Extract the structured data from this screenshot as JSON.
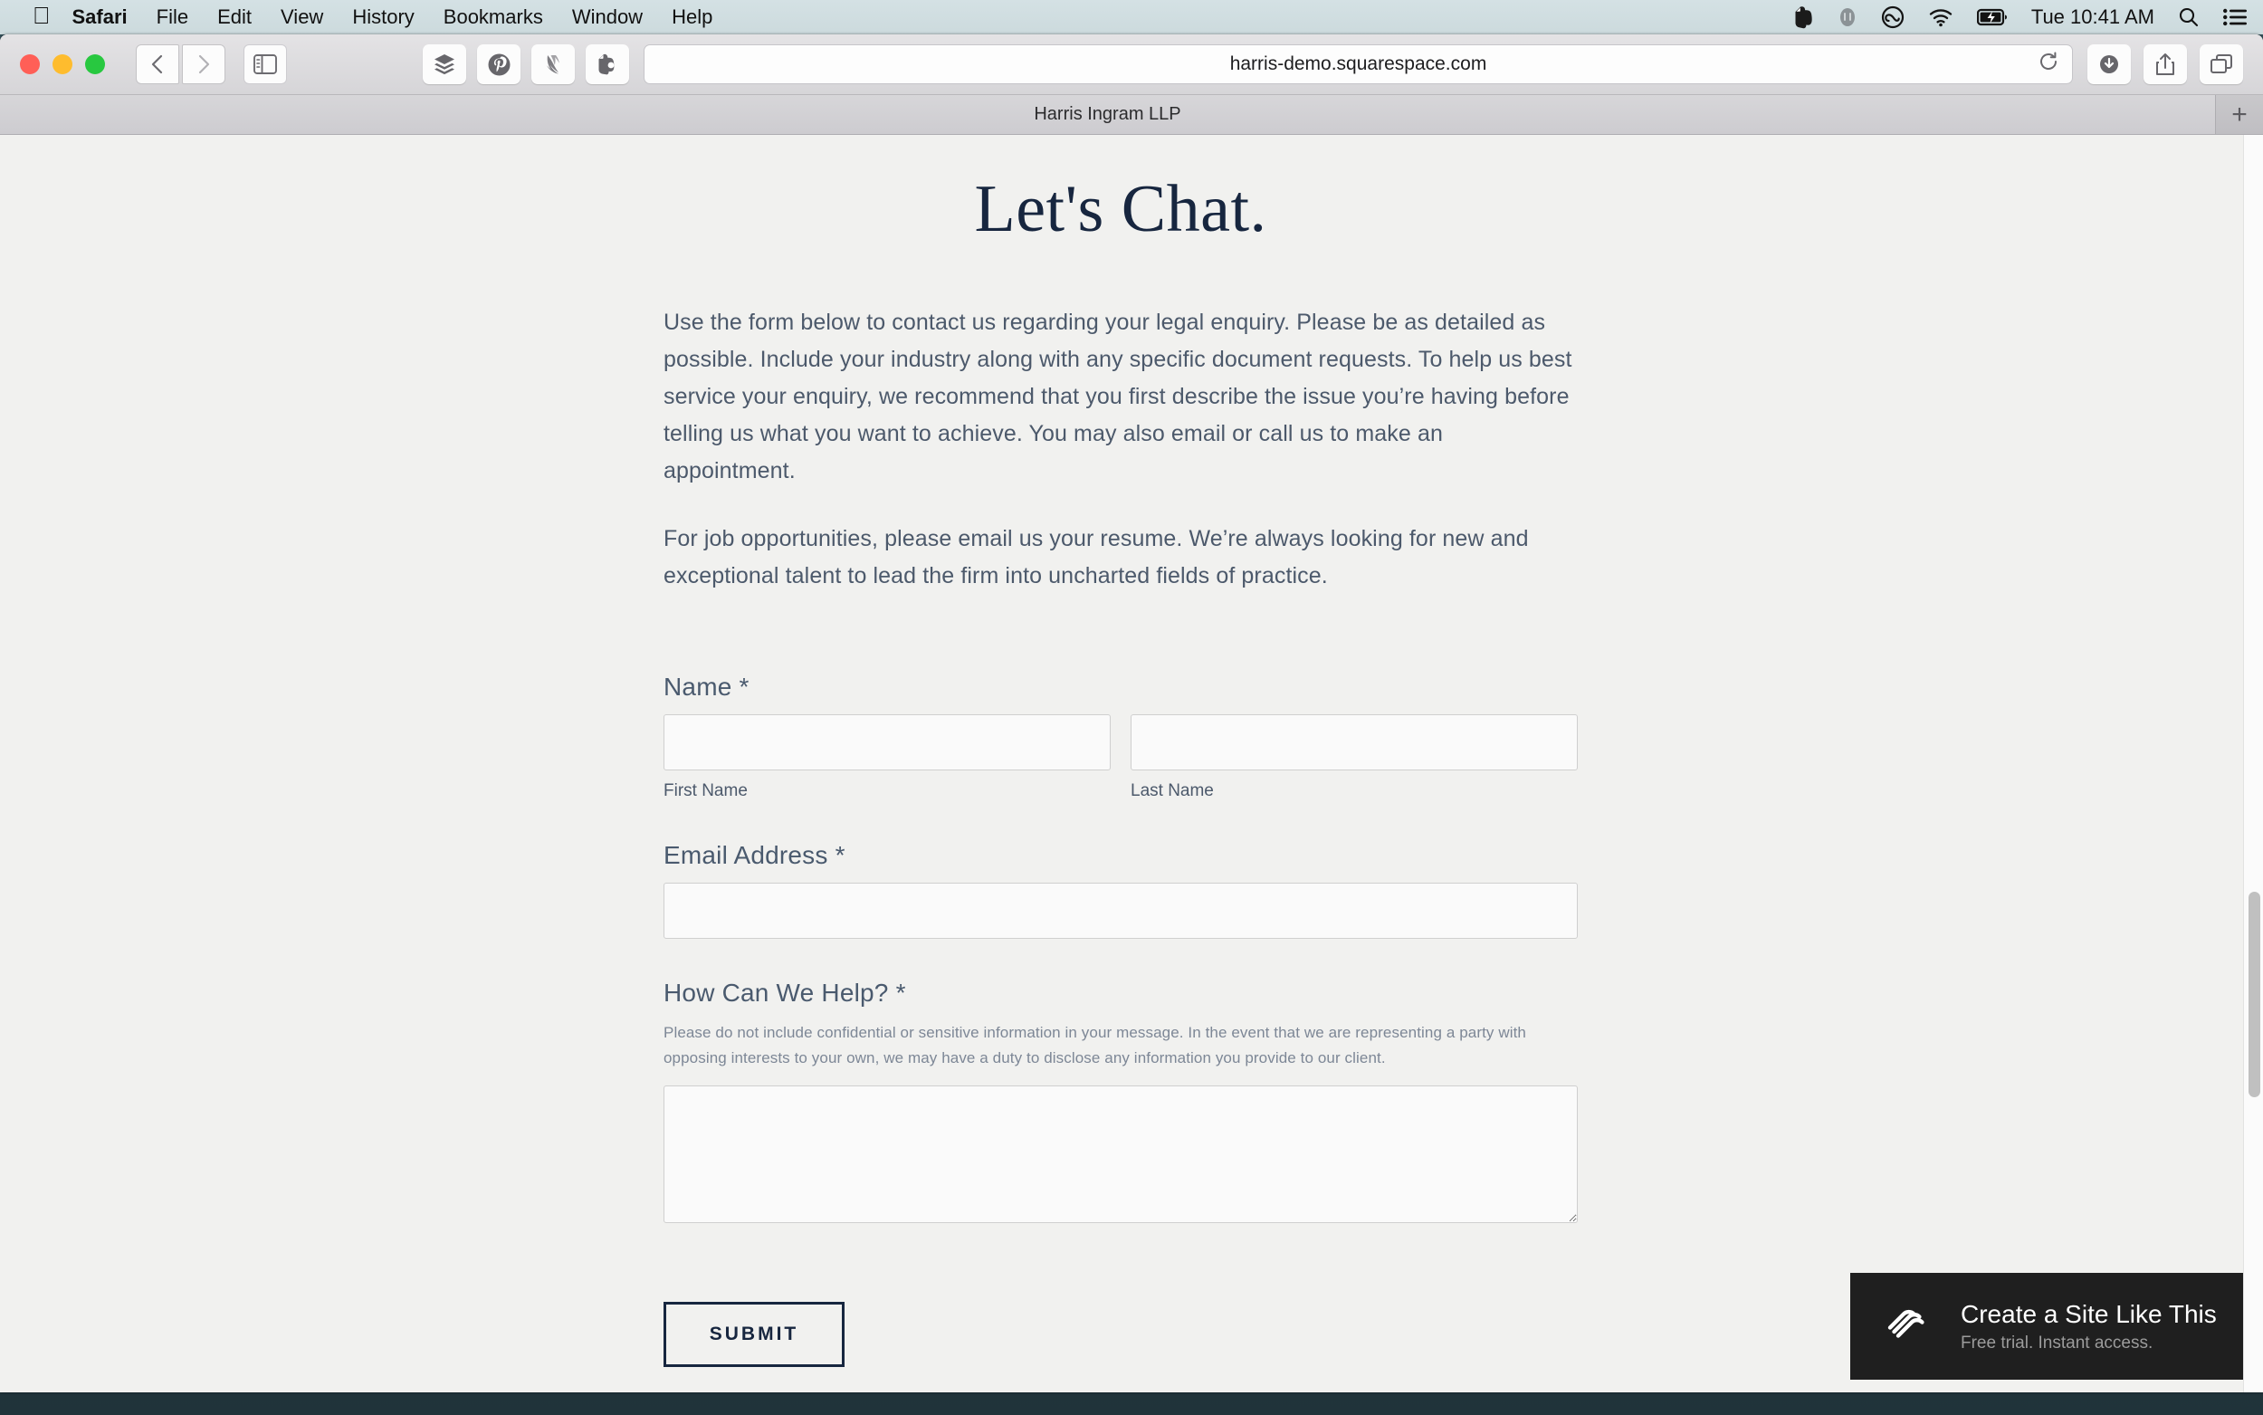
{
  "menubar": {
    "apple_icon": "apple-icon",
    "items": [
      {
        "label": "Safari",
        "bold": true
      },
      {
        "label": "File",
        "bold": false
      },
      {
        "label": "Edit",
        "bold": false
      },
      {
        "label": "View",
        "bold": false
      },
      {
        "label": "History",
        "bold": false
      },
      {
        "label": "Bookmarks",
        "bold": false
      },
      {
        "label": "Window",
        "bold": false
      },
      {
        "label": "Help",
        "bold": false
      }
    ],
    "status_icons": [
      "evernote-icon",
      "dropbox-icon",
      "creative-cloud-icon",
      "wifi-icon",
      "battery-charging-icon"
    ],
    "clock": "Tue 10:41 AM",
    "search_icon": "search-icon",
    "notification_center_icon": "notification-center-icon"
  },
  "toolbar": {
    "back_icon": "chevron-left-icon",
    "forward_icon": "chevron-right-icon",
    "sidebar_icon": "sidebar-icon",
    "bookmarks": [
      "layers-icon",
      "pinterest-icon",
      "swift-icon",
      "evernote-icon"
    ],
    "url": "harris-demo.squarespace.com",
    "reload_icon": "reload-icon",
    "downloads_icon": "downloads-icon",
    "share_icon": "share-icon",
    "tab-overview_icon": "tab-overview-icon"
  },
  "tabbar": {
    "active_tab_title": "Harris Ingram LLP",
    "new_tab_label": "+"
  },
  "page": {
    "headline": "Let's Chat.",
    "paragraphs": [
      "Use the form below to contact us regarding your legal enquiry. Please be as detailed as possible. Include your industry along with any specific document requests. To help us best service your enquiry, we recommend that you first describe the issue you’re having before telling us what you want to achieve. You may also email or call us to make an appointment.",
      "For job opportunities, please email us your resume. We’re always looking for new and exceptional talent to lead the firm into uncharted fields of practice."
    ],
    "form": {
      "name": {
        "label": "Name",
        "required_mark": "*",
        "first": {
          "value": "",
          "placeholder": "",
          "sublabel": "First Name"
        },
        "last": {
          "value": "",
          "placeholder": "",
          "sublabel": "Last Name"
        }
      },
      "email": {
        "label": "Email Address",
        "required_mark": "*",
        "value": "",
        "placeholder": ""
      },
      "message": {
        "label": "How Can We Help?",
        "required_mark": "*",
        "helper": "Please do not include confidential or sensitive information in your message. In the event that we are representing a party with opposing interests to your own, we may have a duty to disclose any information you provide to our client.",
        "value": "",
        "placeholder": ""
      },
      "submit_label": "SUBMIT"
    },
    "promo": {
      "logo_icon": "squarespace-logo-icon",
      "title": "Create a Site Like This",
      "subtitle": "Free trial. Instant access."
    }
  },
  "colors": {
    "page_bg": "#f1f1ef",
    "heading_navy": "#17263f",
    "body_text": "#4c596b",
    "helper_text": "#7d8796",
    "promo_bg": "#1f1f1f"
  }
}
